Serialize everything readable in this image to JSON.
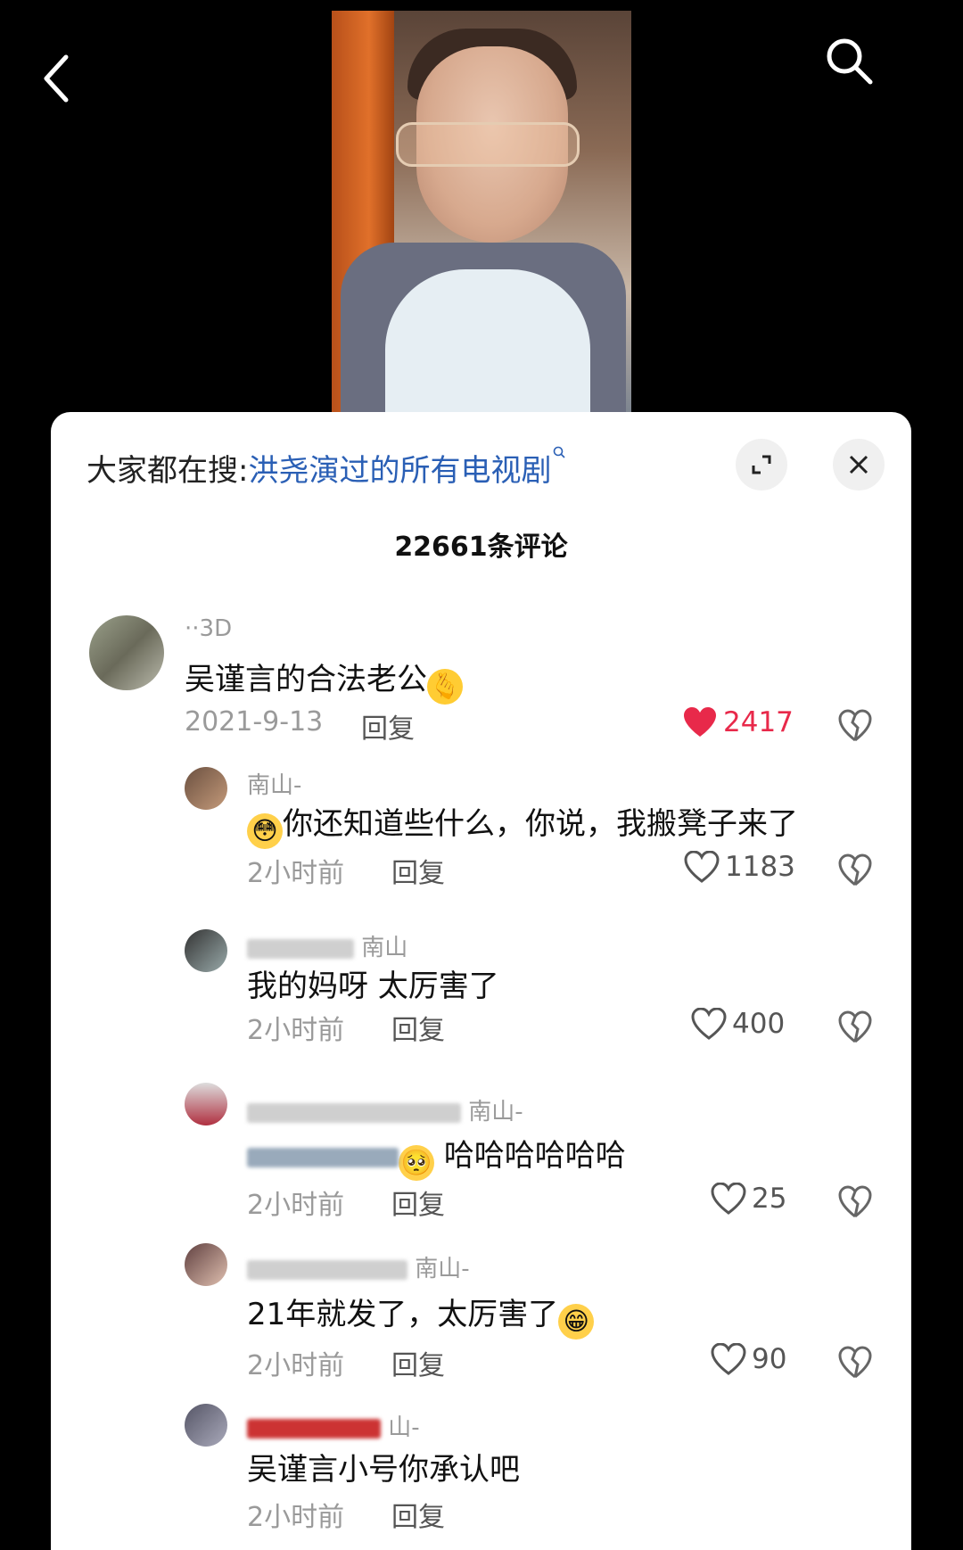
{
  "sheet": {
    "search_prefix": "大家都在搜:",
    "search_query": "洪尧演过的所有电视剧",
    "comment_count": "22661条评论"
  },
  "icons": {
    "back": "chevron-left-icon",
    "search": "search-icon",
    "expand": "expand-icon",
    "close": "close-icon",
    "like": "heart-icon",
    "dislike": "broken-heart-icon"
  },
  "colors": {
    "like_active": "#e8294a",
    "link": "#2a5fb5"
  },
  "comments": [
    {
      "user": "··3D",
      "text": "吴谨言的合法老公",
      "date": "2021-9-13",
      "reply": "回复",
      "likes": "2417"
    },
    {
      "user": "南山-",
      "text": "你还知道些什么，你说，我搬凳子来了",
      "date": "2小时前",
      "reply": "回复",
      "likes": "1183"
    },
    {
      "user": "南山",
      "text": "我的妈呀 太厉害了",
      "date": "2小时前",
      "reply": "回复",
      "likes": "400"
    },
    {
      "user": "南山-",
      "text": "哈哈哈哈哈哈",
      "date": "2小时前",
      "reply": "回复",
      "likes": "25"
    },
    {
      "user": "南山-",
      "text": "21年就发了，太厉害了",
      "date": "2小时前",
      "reply": "回复",
      "likes": "90"
    },
    {
      "user": "山-",
      "text": "吴谨言小号你承认吧",
      "date": "2小时前",
      "reply": "回复",
      "likes": ""
    }
  ]
}
